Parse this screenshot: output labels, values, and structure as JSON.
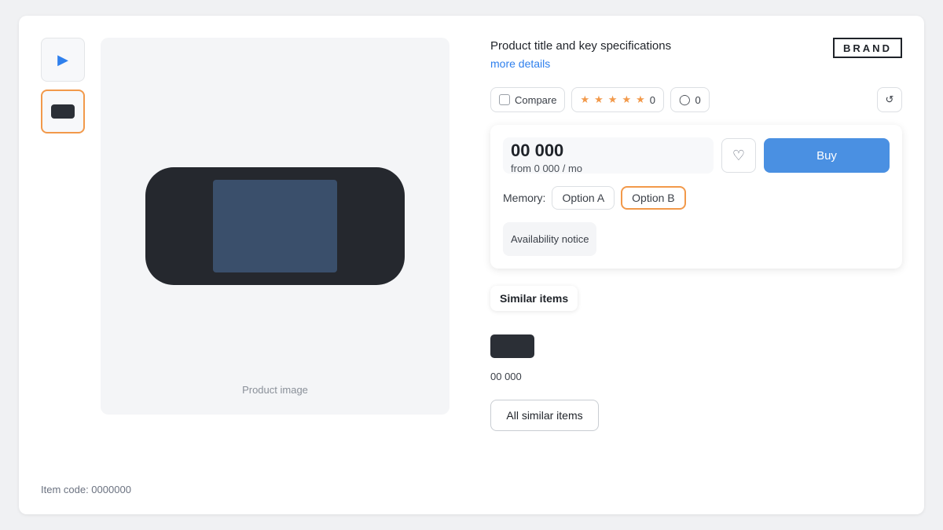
{
  "product": {
    "title": "Product title and key specifications",
    "more_link": "more details",
    "brand": "BRAND",
    "sku": "Item code: 0000000"
  },
  "gallery": {
    "main_caption": "Product image"
  },
  "actions": {
    "compare_label": "Compare",
    "rating_count": "0",
    "reviews_count": "0"
  },
  "price": {
    "amount": "00 000",
    "installment": "from 0 000 / mo",
    "buy_label": "Buy"
  },
  "options": {
    "label": "Memory:",
    "items": [
      {
        "label": "Option A"
      },
      {
        "label": "Option B"
      }
    ]
  },
  "notice": "Availability notice",
  "related": {
    "tab_label": "Similar items",
    "item_price": "00 000",
    "all_label": "All similar items"
  },
  "colors": {
    "accent": "#f2994a",
    "primary_button": "#4a90e2"
  }
}
